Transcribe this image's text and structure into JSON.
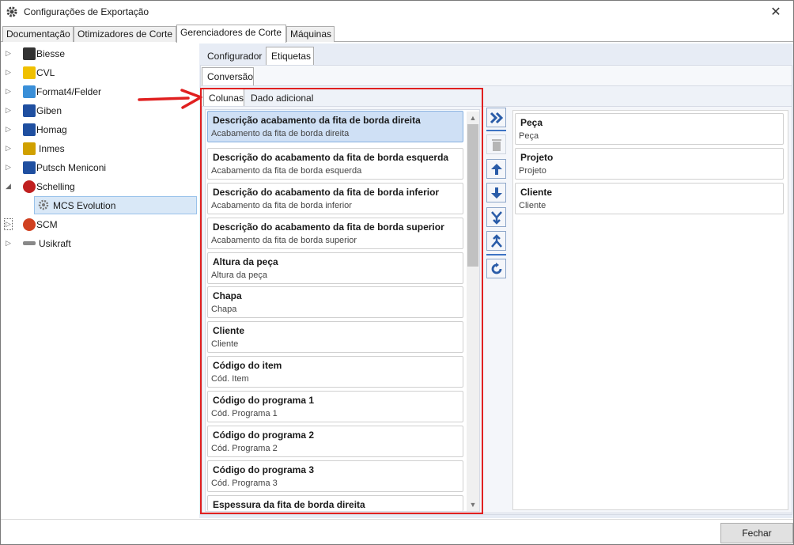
{
  "window": {
    "title": "Configurações de Exportação",
    "close_glyph": "✕"
  },
  "top_tabs": [
    {
      "label": "Documentação"
    },
    {
      "label": "Otimizadores de Corte"
    },
    {
      "label": "Gerenciadores de Corte"
    },
    {
      "label": "Máquinas"
    }
  ],
  "tree": [
    {
      "label": "Biesse",
      "icon": "biesse-logo-icon",
      "color": "#333333"
    },
    {
      "label": "CVL",
      "icon": "cvl-logo-icon",
      "color": "#f0c000"
    },
    {
      "label": "Format4/Felder",
      "icon": "format4-logo-icon",
      "color": "#3a8fd8"
    },
    {
      "label": "Giben",
      "icon": "giben-logo-icon",
      "color": "#1f4fa0"
    },
    {
      "label": "Homag",
      "icon": "homag-logo-icon",
      "color": "#1f4fa0"
    },
    {
      "label": "Inmes",
      "icon": "inmes-logo-icon",
      "color": "#d0a000"
    },
    {
      "label": "Putsch Meniconi",
      "icon": "putsch-logo-icon",
      "color": "#1f4fa0"
    },
    {
      "label": "Schelling",
      "icon": "schelling-logo-icon",
      "color": "#c02020"
    },
    {
      "label": "MCS Evolution",
      "icon": "gear-icon",
      "color": "#888888"
    },
    {
      "label": "SCM",
      "icon": "scm-logo-icon",
      "color": "#d04020"
    },
    {
      "label": "Usikraft",
      "icon": "usikraft-logo-icon",
      "color": "#888888"
    }
  ],
  "sub_tabs": {
    "level1": [
      "Configurador",
      "Etiquetas"
    ],
    "level2": [
      "Conversão"
    ],
    "level3": [
      "Colunas",
      "Dado adicional"
    ]
  },
  "available_columns": [
    {
      "title": "Descrição acabamento da fita de borda direita",
      "sub": "Acabamento da fita de borda direita"
    },
    {
      "title": "Descrição do acabamento da fita de borda esquerda",
      "sub": "Acabamento da fita de borda esquerda"
    },
    {
      "title": "Descrição do acabamento da fita de borda inferior",
      "sub": "Acabamento da fita de borda inferior"
    },
    {
      "title": "Descrição do acabamento da fita de borda superior",
      "sub": "Acabamento da fita de borda superior"
    },
    {
      "title": "Altura da peça",
      "sub": "Altura da peça"
    },
    {
      "title": "Chapa",
      "sub": "Chapa"
    },
    {
      "title": "Cliente",
      "sub": "Cliente"
    },
    {
      "title": "Código do item",
      "sub": "Cód. Item"
    },
    {
      "title": "Código do programa 1",
      "sub": "Cód. Programa 1"
    },
    {
      "title": "Código do programa 2",
      "sub": "Cód. Programa 2"
    },
    {
      "title": "Código do programa 3",
      "sub": "Cód. Programa 3"
    },
    {
      "title": "Espessura da fita de borda direita",
      "sub": ""
    }
  ],
  "selected_columns": [
    {
      "title": "Peça",
      "sub": "Peça"
    },
    {
      "title": "Projeto",
      "sub": "Projeto"
    },
    {
      "title": "Cliente",
      "sub": "Cliente"
    }
  ],
  "toolbar": [
    {
      "icon": "move-all-right-icon"
    },
    {
      "icon": "delete-icon"
    },
    {
      "icon": "move-up-icon"
    },
    {
      "icon": "move-down-icon"
    },
    {
      "icon": "merge-icon"
    },
    {
      "icon": "split-icon"
    },
    {
      "icon": "refresh-icon"
    }
  ],
  "footer": {
    "close_label": "Fechar"
  },
  "colors": {
    "annotation": "#e02020",
    "accent": "#3d73c4",
    "selected": "#cfe0f5"
  }
}
